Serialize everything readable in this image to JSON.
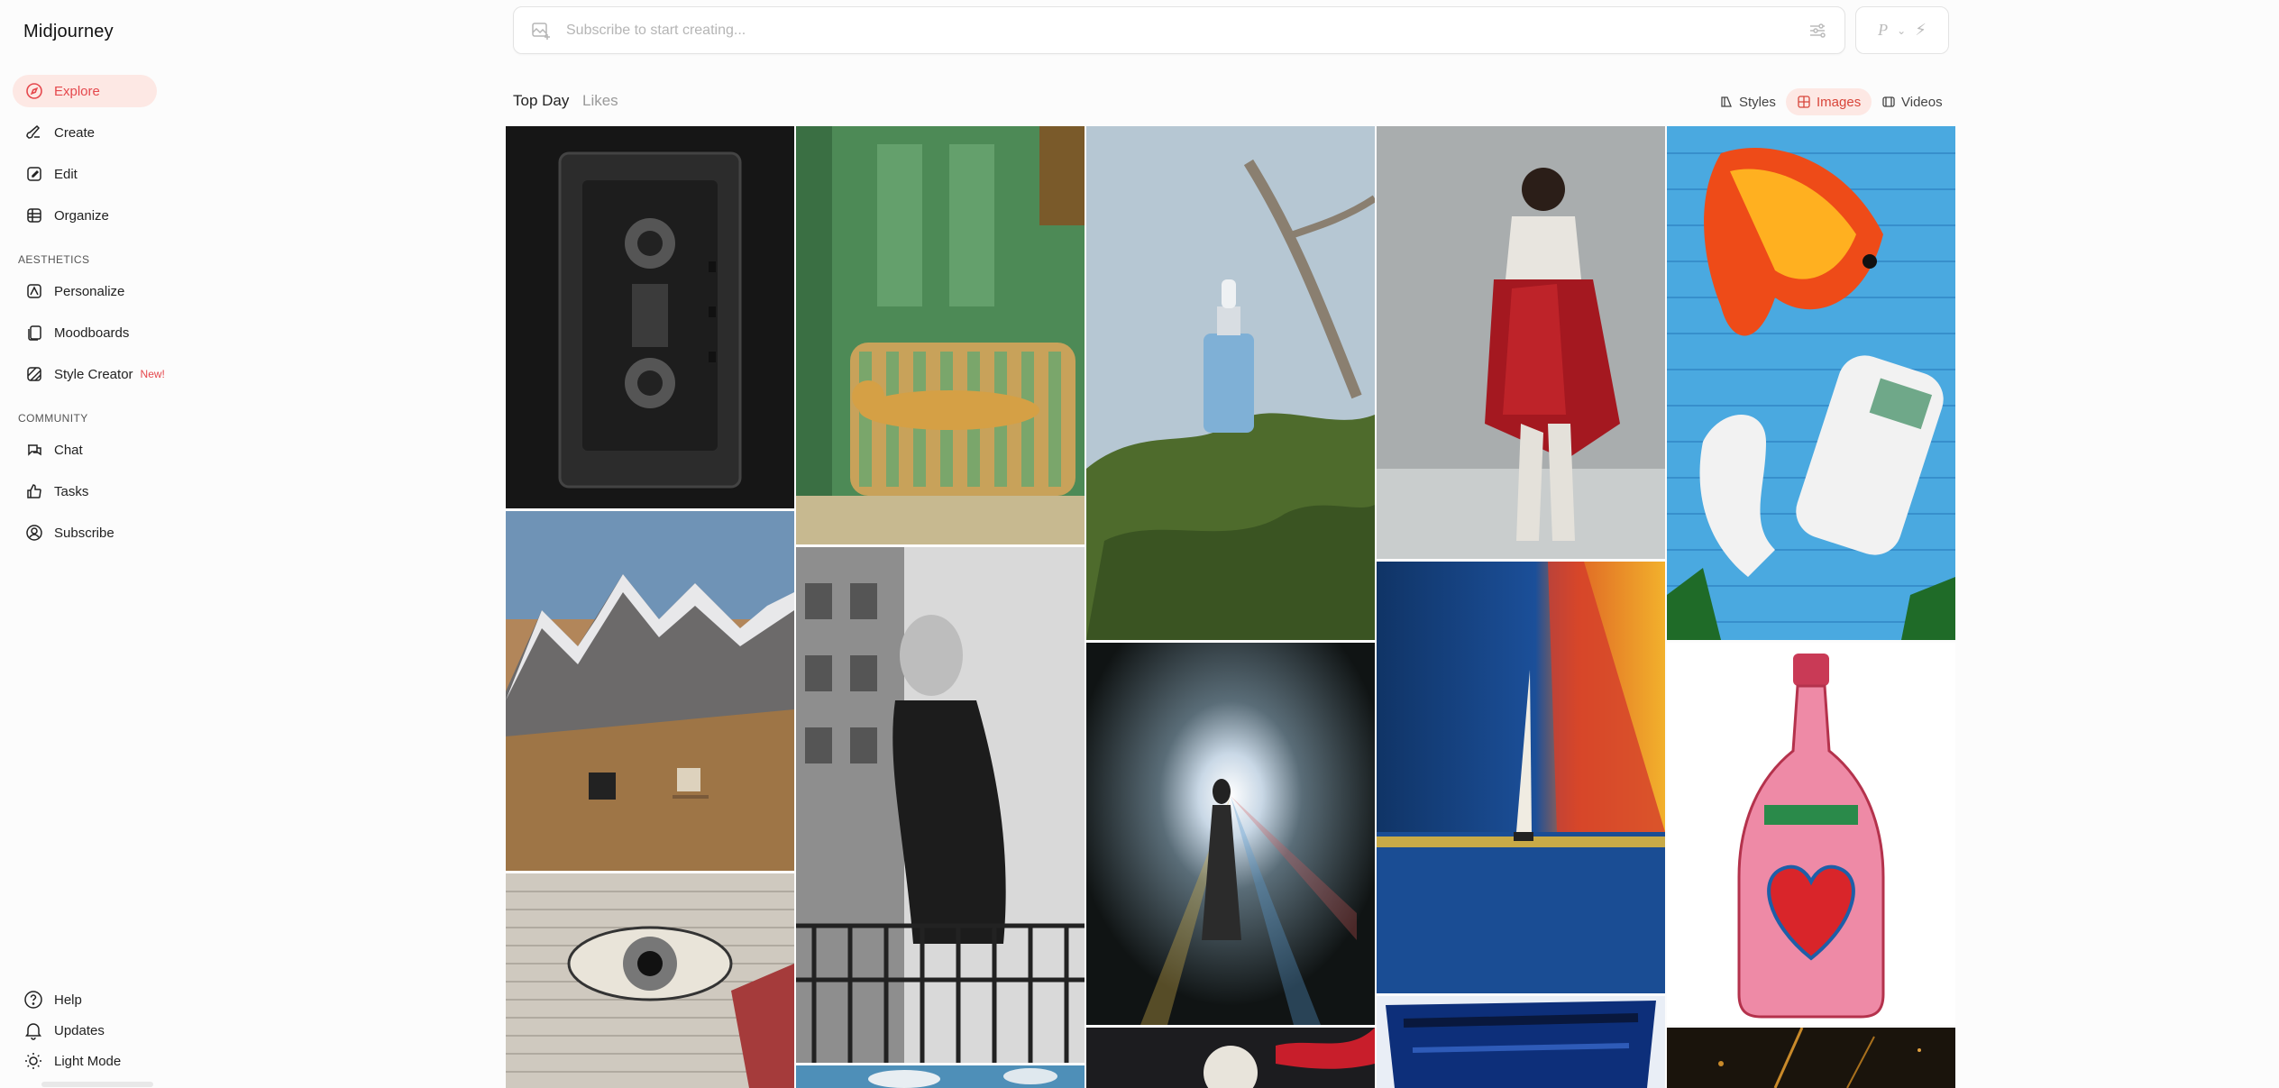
{
  "app": {
    "title": "Midjourney"
  },
  "sidebar": {
    "primary": [
      {
        "label": "Explore",
        "icon": "compass-icon"
      },
      {
        "label": "Create",
        "icon": "brush-icon"
      },
      {
        "label": "Edit",
        "icon": "edit-icon"
      },
      {
        "label": "Organize",
        "icon": "grid-icon"
      }
    ],
    "aesthetics_label": "AESTHETICS",
    "aesthetics": [
      {
        "label": "Personalize",
        "icon": "personalize-icon"
      },
      {
        "label": "Moodboards",
        "icon": "moodboards-icon"
      },
      {
        "label": "Style Creator",
        "icon": "style-creator-icon",
        "badge": "New!"
      }
    ],
    "community_label": "COMMUNITY",
    "community": [
      {
        "label": "Chat",
        "icon": "chat-icon"
      },
      {
        "label": "Tasks",
        "icon": "thumbs-up-icon"
      },
      {
        "label": "Subscribe",
        "icon": "user-circle-icon"
      }
    ],
    "bottom": [
      {
        "label": "Help",
        "icon": "help-icon"
      },
      {
        "label": "Updates",
        "icon": "bell-icon"
      },
      {
        "label": "Light Mode",
        "icon": "sun-icon"
      }
    ]
  },
  "prompt": {
    "placeholder": "Subscribe to start creating..."
  },
  "mode": {
    "p_label": "P"
  },
  "feed_tabs": {
    "top_day": "Top Day",
    "likes": "Likes"
  },
  "view_tabs": {
    "styles": "Styles",
    "images": "Images",
    "videos": "Videos"
  },
  "accent_color": "#e5484d",
  "gallery": [
    "cassette-tape-image",
    "cheetah-sofa-image",
    "serum-bottle-image",
    "red-bag-image",
    "goldfish-telephone-image",
    "mountain-man-image",
    "woman-balcony-image",
    "light-figure-image",
    "sailboat-sunset-image",
    "champagne-heart-image",
    "engraved-eye-image",
    "moon-red-image",
    "blue-ink-image",
    "dark-sparks-image",
    "blue-sky-image"
  ]
}
